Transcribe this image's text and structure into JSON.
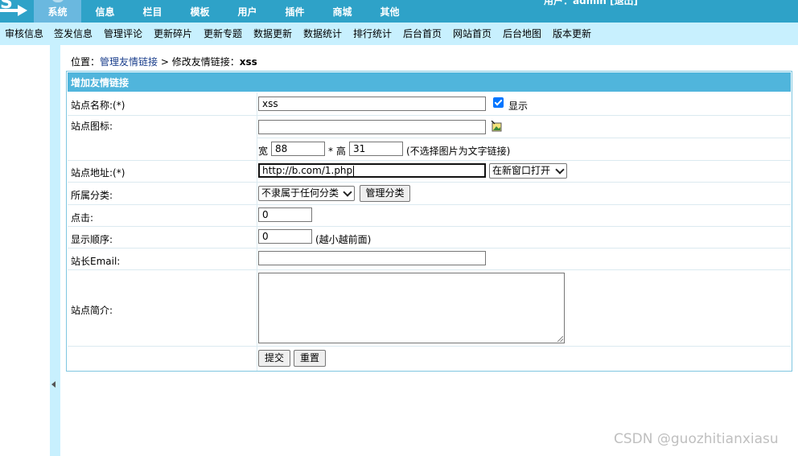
{
  "colors": {
    "top_bar": "#2ea2c8",
    "active_tab": "#6ab8df",
    "sub_bar": "#c8f0fe",
    "form_header": "#50b5dc",
    "link": "#1a3e8c"
  },
  "header": {
    "logo_letter": "S",
    "tabs": [
      "系统",
      "信息",
      "栏目",
      "模板",
      "用户",
      "插件",
      "商城",
      "其他"
    ],
    "active_tab": "系统",
    "user_text": "用户：admin  [退出]"
  },
  "sub_nav": [
    "审核信息",
    "签发信息",
    "管理评论",
    "更新碎片",
    "更新专题",
    "数据更新",
    "数据统计",
    "排行统计",
    "后台首页",
    "网站首页",
    "后台地图",
    "版本更新"
  ],
  "breadcrumb": {
    "prefix": "位置：",
    "link": "管理友情链接",
    "sep": " > ",
    "current_label": "修改友情链接：",
    "current_name": "xss"
  },
  "form": {
    "title": "增加友情链接",
    "site_name": {
      "label": "站点名称:(*)",
      "value": "xss",
      "show_label": "显示",
      "show_checked": true
    },
    "site_icon": {
      "label": "站点图标:",
      "value": "",
      "icon": "image-picker-icon",
      "width_label": "宽",
      "width_value": "88",
      "height_label": "* 高",
      "height_value": "31",
      "hint": "(不选择图片为文字链接)"
    },
    "site_url": {
      "label": "站点地址:(*)",
      "value": "http://b.com/1.php",
      "target_selected": "在新窗口打开"
    },
    "category": {
      "label": "所属分类:",
      "selected": "不隶属于任何分类",
      "manage_button": "管理分类"
    },
    "clicks": {
      "label": "点击:",
      "value": "0"
    },
    "order": {
      "label": "显示顺序:",
      "value": "0",
      "hint": "(越小越前面)"
    },
    "email": {
      "label": "站长Email:",
      "value": ""
    },
    "intro": {
      "label": "站点简介:",
      "value": ""
    },
    "submit_button": "提交",
    "reset_button": "重置"
  },
  "watermark": "CSDN @guozhitianxiasu"
}
